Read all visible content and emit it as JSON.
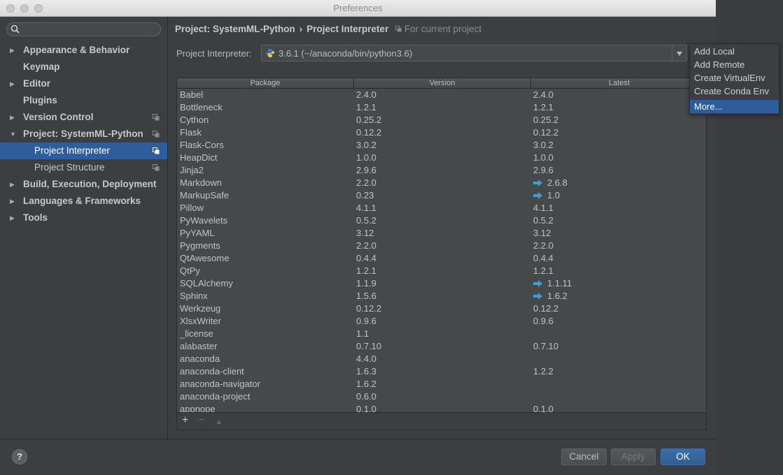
{
  "window": {
    "title": "Preferences"
  },
  "sidebar": {
    "search_placeholder": "",
    "items": [
      {
        "label": "Appearance & Behavior",
        "arrow": "▶",
        "sub": false,
        "copy": false,
        "selected": false
      },
      {
        "label": "Keymap",
        "arrow": "",
        "sub": false,
        "copy": false,
        "selected": false
      },
      {
        "label": "Editor",
        "arrow": "▶",
        "sub": false,
        "copy": false,
        "selected": false
      },
      {
        "label": "Plugins",
        "arrow": "",
        "sub": false,
        "copy": false,
        "selected": false
      },
      {
        "label": "Version Control",
        "arrow": "▶",
        "sub": false,
        "copy": true,
        "selected": false
      },
      {
        "label": "Project: SystemML-Python",
        "arrow": "▼",
        "sub": false,
        "copy": true,
        "selected": false
      },
      {
        "label": "Project Interpreter",
        "arrow": "",
        "sub": true,
        "copy": true,
        "selected": true
      },
      {
        "label": "Project Structure",
        "arrow": "",
        "sub": true,
        "copy": true,
        "selected": false
      },
      {
        "label": "Build, Execution, Deployment",
        "arrow": "▶",
        "sub": false,
        "copy": false,
        "selected": false
      },
      {
        "label": "Languages & Frameworks",
        "arrow": "▶",
        "sub": false,
        "copy": false,
        "selected": false
      },
      {
        "label": "Tools",
        "arrow": "▶",
        "sub": false,
        "copy": false,
        "selected": false
      }
    ]
  },
  "breadcrumb": {
    "project": "Project: SystemML-Python",
    "separator": "›",
    "page": "Project Interpreter",
    "hint": "For current project"
  },
  "interpreter": {
    "label": "Project Interpreter:",
    "value": "3.6.1 (~/anaconda/bin/python3.6)"
  },
  "table": {
    "headers": [
      "Package",
      "Version",
      "Latest"
    ],
    "rows": [
      {
        "package": "Babel",
        "version": "2.4.0",
        "latest": "2.4.0",
        "upgrade": false
      },
      {
        "package": "Bottleneck",
        "version": "1.2.1",
        "latest": "1.2.1",
        "upgrade": false
      },
      {
        "package": "Cython",
        "version": "0.25.2",
        "latest": "0.25.2",
        "upgrade": false
      },
      {
        "package": "Flask",
        "version": "0.12.2",
        "latest": "0.12.2",
        "upgrade": false
      },
      {
        "package": "Flask-Cors",
        "version": "3.0.2",
        "latest": "3.0.2",
        "upgrade": false
      },
      {
        "package": "HeapDict",
        "version": "1.0.0",
        "latest": "1.0.0",
        "upgrade": false
      },
      {
        "package": "Jinja2",
        "version": "2.9.6",
        "latest": "2.9.6",
        "upgrade": false
      },
      {
        "package": "Markdown",
        "version": "2.2.0",
        "latest": "2.6.8",
        "upgrade": true
      },
      {
        "package": "MarkupSafe",
        "version": "0.23",
        "latest": "1.0",
        "upgrade": true
      },
      {
        "package": "Pillow",
        "version": "4.1.1",
        "latest": "4.1.1",
        "upgrade": false
      },
      {
        "package": "PyWavelets",
        "version": "0.5.2",
        "latest": "0.5.2",
        "upgrade": false
      },
      {
        "package": "PyYAML",
        "version": "3.12",
        "latest": "3.12",
        "upgrade": false
      },
      {
        "package": "Pygments",
        "version": "2.2.0",
        "latest": "2.2.0",
        "upgrade": false
      },
      {
        "package": "QtAwesome",
        "version": "0.4.4",
        "latest": "0.4.4",
        "upgrade": false
      },
      {
        "package": "QtPy",
        "version": "1.2.1",
        "latest": "1.2.1",
        "upgrade": false
      },
      {
        "package": "SQLAlchemy",
        "version": "1.1.9",
        "latest": "1.1.11",
        "upgrade": true
      },
      {
        "package": "Sphinx",
        "version": "1.5.6",
        "latest": "1.6.2",
        "upgrade": true
      },
      {
        "package": "Werkzeug",
        "version": "0.12.2",
        "latest": "0.12.2",
        "upgrade": false
      },
      {
        "package": "XlsxWriter",
        "version": "0.9.6",
        "latest": "0.9.6",
        "upgrade": false
      },
      {
        "package": "_license",
        "version": "1.1",
        "latest": "",
        "upgrade": false
      },
      {
        "package": "alabaster",
        "version": "0.7.10",
        "latest": "0.7.10",
        "upgrade": false
      },
      {
        "package": "anaconda",
        "version": "4.4.0",
        "latest": "",
        "upgrade": false
      },
      {
        "package": "anaconda-client",
        "version": "1.6.3",
        "latest": "1.2.2",
        "upgrade": false
      },
      {
        "package": "anaconda-navigator",
        "version": "1.6.2",
        "latest": "",
        "upgrade": false
      },
      {
        "package": "anaconda-project",
        "version": "0.6.0",
        "latest": "",
        "upgrade": false
      },
      {
        "package": "appnope",
        "version": "0.1.0",
        "latest": "0.1.0",
        "upgrade": false
      }
    ],
    "toolbar": {
      "add": "+",
      "remove": "−",
      "upgrade": "▲"
    }
  },
  "popup_menu": {
    "items": [
      "Add Local",
      "Add Remote",
      "Create VirtualEnv",
      "Create Conda Env",
      "More..."
    ],
    "selected_index": 4
  },
  "footer": {
    "help": "?",
    "cancel": "Cancel",
    "apply": "Apply",
    "ok": "OK"
  },
  "colors": {
    "selection": "#2d5d9a",
    "upgrade_arrow": "#3e9cd8"
  }
}
